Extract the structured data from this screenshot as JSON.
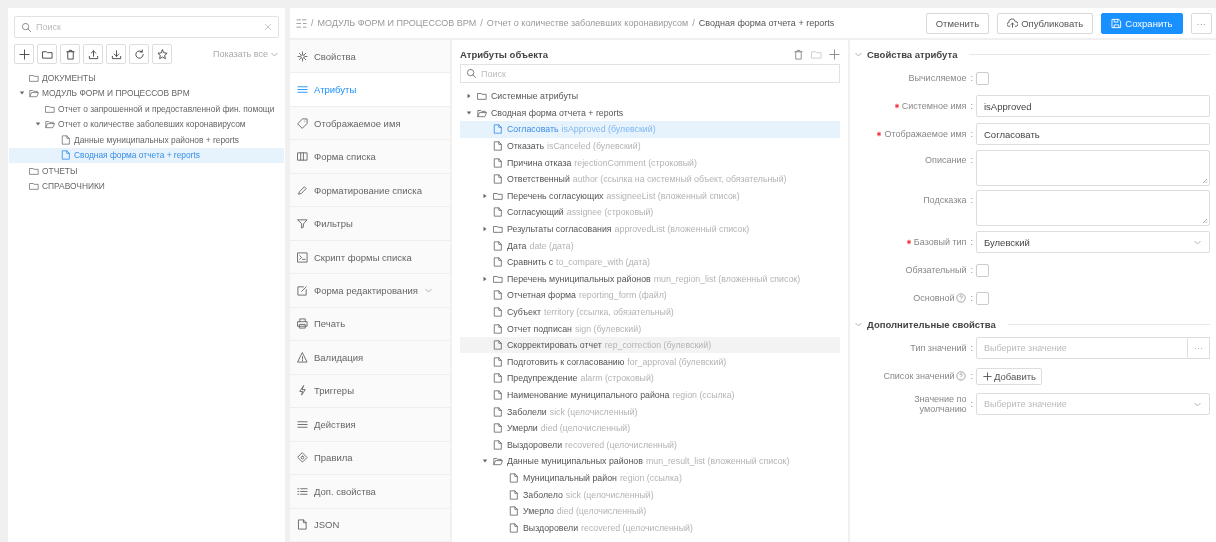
{
  "sidebar": {
    "search": {
      "placeholder": "Поиск"
    },
    "show_all": "Показать все",
    "tree": [
      {
        "label": "ДОКУМЕНТЫ",
        "kind": "folder",
        "selected": false
      },
      {
        "label": "МОДУЛЬ ФОРМ И ПРОЦЕССОВ BPM",
        "kind": "folder",
        "expanded": true,
        "selected": false,
        "children": [
          {
            "label": "Отчет о запрошенной и предоставленной фин. помощи",
            "kind": "folder",
            "selected": false
          },
          {
            "label": "Отчет о количестве заболевших коронавирусом",
            "kind": "folder",
            "expanded": true,
            "selected": false,
            "children": [
              {
                "label": "Данные муниципальных районов + reports",
                "kind": "file",
                "selected": false
              },
              {
                "label": "Сводная форма отчета + reports",
                "kind": "file",
                "selected": true
              }
            ]
          }
        ]
      },
      {
        "label": "ОТЧЕТЫ",
        "kind": "folder",
        "selected": false
      },
      {
        "label": "СПРАВОЧНИКИ",
        "kind": "folder",
        "selected": false
      }
    ]
  },
  "breadcrumb": {
    "separator": "/",
    "items": [
      "МОДУЛЬ ФОРМ И ПРОЦЕССОВ BPM",
      "Отчет о количестве заболевших коронавирусом",
      "Сводная форма отчета + reports"
    ]
  },
  "actions": [
    {
      "label": "Отменить",
      "kind": "cancel"
    },
    {
      "label": "Опубликовать",
      "kind": "publish"
    },
    {
      "label": "Сохранить",
      "kind": "save"
    },
    {
      "label": "···",
      "kind": "more"
    }
  ],
  "nav": [
    {
      "label": "Свойства",
      "kind": "settings",
      "selected": false
    },
    {
      "label": "Атрибуты",
      "kind": "list",
      "selected": true
    },
    {
      "label": "Отображаемое имя",
      "kind": "tag",
      "selected": false
    },
    {
      "label": "Форма списка",
      "kind": "table",
      "selected": false
    },
    {
      "label": "Форматирование списка",
      "kind": "brush",
      "selected": false
    },
    {
      "label": "Фильтры",
      "kind": "filter",
      "selected": false
    },
    {
      "label": "Скрипт формы списка",
      "kind": "script",
      "selected": false
    },
    {
      "label": "Форма редактирования",
      "kind": "edit",
      "selected": false,
      "expandable": true
    },
    {
      "label": "Печать",
      "kind": "print",
      "selected": false
    },
    {
      "label": "Валидация",
      "kind": "warning",
      "selected": false
    },
    {
      "label": "Триггеры",
      "kind": "trigger",
      "selected": false
    },
    {
      "label": "Действия",
      "kind": "actions",
      "selected": false
    },
    {
      "label": "Правила",
      "kind": "rules",
      "selected": false
    },
    {
      "label": "Доп. свойства",
      "kind": "extra",
      "selected": false
    },
    {
      "label": "JSON",
      "kind": "json",
      "selected": false
    }
  ],
  "attributes": {
    "title": "Атрибуты объекта",
    "search": {
      "placeholder": "Поиск"
    },
    "tree": [
      {
        "title": "Системные атрибуты",
        "kind": "folder",
        "expanded": false,
        "selected": false,
        "hovered": false
      },
      {
        "title": "Сводная форма отчета + reports",
        "kind": "folder",
        "expanded": true,
        "selected": false,
        "hovered": false,
        "children": [
          {
            "title": "Согласовать",
            "detail": "isApproved (булевский)",
            "kind": "file",
            "selected": true,
            "hovered": false
          },
          {
            "title": "Отказать",
            "detail": "isCanceled (булевский)",
            "kind": "file",
            "selected": false,
            "hovered": false
          },
          {
            "title": "Причина отказа",
            "detail": "rejectionComment (строковый)",
            "kind": "file",
            "selected": false,
            "hovered": false
          },
          {
            "title": "Ответственный",
            "detail": "author (ссылка на системный объект, обязательный)",
            "kind": "file",
            "selected": false,
            "hovered": false
          },
          {
            "title": "Перечень согласующих",
            "detail": "assigneeList (вложенный список)",
            "kind": "folder",
            "expanded": false,
            "selected": false,
            "hovered": false
          },
          {
            "title": "Согласующий",
            "detail": "assignee (строковый)",
            "kind": "file",
            "selected": false,
            "hovered": false
          },
          {
            "title": "Результаты согласования",
            "detail": "approvedList (вложенный список)",
            "kind": "folder",
            "expanded": false,
            "selected": false,
            "hovered": false
          },
          {
            "title": "Дата",
            "detail": "date (дата)",
            "kind": "file",
            "selected": false,
            "hovered": false
          },
          {
            "title": "Сравнить с",
            "detail": "to_compare_with (дата)",
            "kind": "file",
            "selected": false,
            "hovered": false
          },
          {
            "title": "Перечень муниципальных районов",
            "detail": "mun_region_list (вложенный список)",
            "kind": "folder",
            "expanded": false,
            "selected": false,
            "hovered": false
          },
          {
            "title": "Отчетная форма",
            "detail": "reporting_form (файл)",
            "kind": "file",
            "selected": false,
            "hovered": false
          },
          {
            "title": "Субъект",
            "detail": "territory (ссылка, обязательный)",
            "kind": "file",
            "selected": false,
            "hovered": false
          },
          {
            "title": "Отчет подписан",
            "detail": "sign (булевский)",
            "kind": "file",
            "selected": false,
            "hovered": false
          },
          {
            "title": "Скорректировать отчет",
            "detail": "rep_correction (булевский)",
            "kind": "file",
            "selected": false,
            "hovered": true
          },
          {
            "title": "Подготовить к согласованию",
            "detail": "for_approval (булевский)",
            "kind": "file",
            "selected": false,
            "hovered": false
          },
          {
            "title": "Предупреждение",
            "detail": "alarm (строковый)",
            "kind": "file",
            "selected": false,
            "hovered": false
          },
          {
            "title": "Наименование муниципального района",
            "detail": "region (ссылка)",
            "kind": "file",
            "selected": false,
            "hovered": false
          },
          {
            "title": "Заболели",
            "detail": "sick (целочисленный)",
            "kind": "file",
            "selected": false,
            "hovered": false
          },
          {
            "title": "Умерли",
            "detail": "died (целочисленный)",
            "kind": "file",
            "selected": false,
            "hovered": false
          },
          {
            "title": "Выздоровели",
            "detail": "recovered (целочисленный)",
            "kind": "file",
            "selected": false,
            "hovered": false
          },
          {
            "title": "Данные муниципальных районов",
            "detail": "mun_result_list (вложенный список)",
            "kind": "folder",
            "expanded": true,
            "selected": false,
            "hovered": false,
            "children": [
              {
                "title": "Муниципальный район",
                "detail": "region (ссылка)",
                "kind": "file",
                "selected": false,
                "hovered": false
              },
              {
                "title": "Заболело",
                "detail": "sick (целочисленный)",
                "kind": "file",
                "selected": false,
                "hovered": false
              },
              {
                "title": "Умерло",
                "detail": "died (целочисленный)",
                "kind": "file",
                "selected": false,
                "hovered": false
              },
              {
                "title": "Выздоровели",
                "detail": "recovered (целочисленный)",
                "kind": "file",
                "selected": false,
                "hovered": false
              }
            ]
          }
        ]
      }
    ]
  },
  "properties": {
    "sections": [
      {
        "title": "Свойства атрибута",
        "expanded": true,
        "fields": [
          {
            "label": "Вычисляемое",
            "colon": ":",
            "required": false,
            "help": false,
            "kind": "checkbox",
            "checked": false
          },
          {
            "label": "Системное имя",
            "colon": ":",
            "required": true,
            "help": false,
            "kind": "input",
            "value": "isApproved"
          },
          {
            "label": "Отображаемое имя",
            "colon": ":",
            "required": true,
            "help": false,
            "kind": "input",
            "value": "Согласовать"
          },
          {
            "label": "Описание",
            "colon": ":",
            "required": false,
            "help": false,
            "kind": "textarea"
          },
          {
            "label": "Подсказка",
            "colon": ":",
            "required": false,
            "help": false,
            "kind": "textarea"
          },
          {
            "label": "Базовый тип",
            "colon": ":",
            "required": true,
            "help": false,
            "kind": "select",
            "value": "Булевский"
          },
          {
            "label": "Обязательный",
            "colon": ":",
            "required": false,
            "help": false,
            "kind": "checkbox",
            "checked": false
          },
          {
            "label": "Основной",
            "colon": ":",
            "required": false,
            "help": true,
            "kind": "checkbox",
            "checked": false
          }
        ]
      },
      {
        "title": "Дополнительные свойства",
        "expanded": true,
        "fields": [
          {
            "label": "Тип значений",
            "colon": ":",
            "required": false,
            "help": false,
            "kind": "lookup",
            "placeholder": "Выберите значение",
            "button": "···"
          },
          {
            "label": "Список значений",
            "colon": ":",
            "required": false,
            "help": true,
            "kind": "add",
            "button": "Добавить"
          },
          {
            "label": "Значение по умолчанию",
            "colon": ":",
            "required": false,
            "help": false,
            "kind": "select",
            "placeholder": "Выберите значение"
          }
        ]
      }
    ]
  }
}
